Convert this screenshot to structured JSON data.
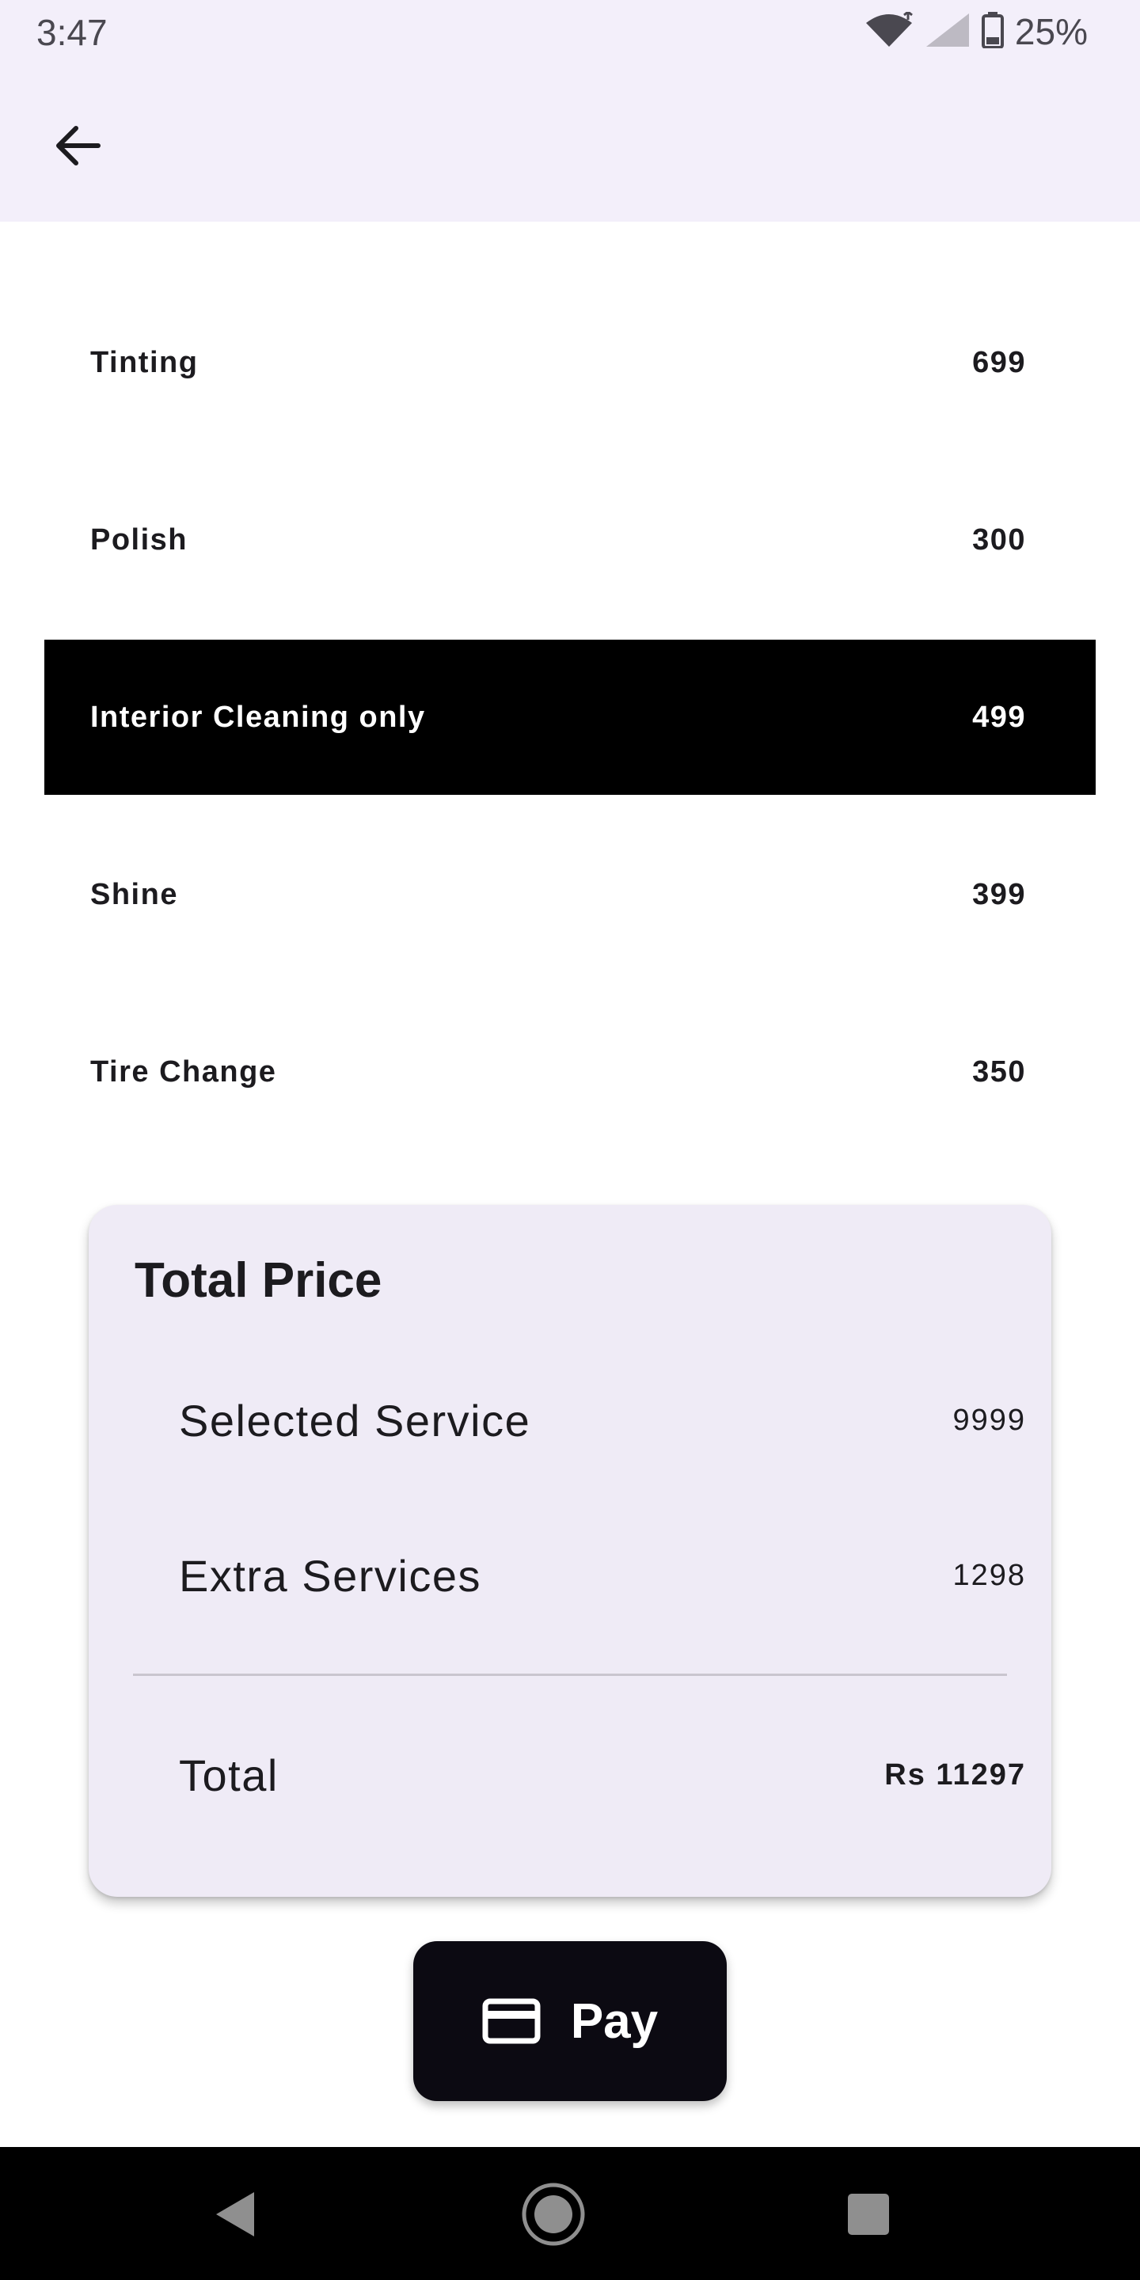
{
  "status_bar": {
    "time": "3:47",
    "battery": "25%",
    "icons": [
      "wifi-icon",
      "signal-icon",
      "battery-icon"
    ]
  },
  "app_bar": {
    "back_icon": "arrow-left-icon"
  },
  "services": [
    {
      "name": "Tinting",
      "price": "699",
      "selected": false
    },
    {
      "name": "Polish",
      "price": "300",
      "selected": false
    },
    {
      "name": "Interior Cleaning only",
      "price": "499",
      "selected": true
    },
    {
      "name": "Shine",
      "price": "399",
      "selected": false
    },
    {
      "name": "Tire Change",
      "price": "350",
      "selected": false
    }
  ],
  "price_card": {
    "title": "Total Price",
    "selected_service_label": "Selected Service",
    "selected_service_value": "9999",
    "extra_services_label": "Extra Services",
    "extra_services_value": "1298",
    "total_label": "Total",
    "total_value": "Rs 11297"
  },
  "pay_button": {
    "label": "Pay",
    "icon": "credit-card-icon"
  },
  "nav_bar": {
    "icons": [
      "back-triangle-icon",
      "home-circle-icon",
      "recents-square-icon"
    ]
  },
  "colors": {
    "header_bg": "#f3effa",
    "card_bg": "#efebf6",
    "selected_row_bg": "#000000",
    "pay_button_bg": "#0c0a12"
  }
}
